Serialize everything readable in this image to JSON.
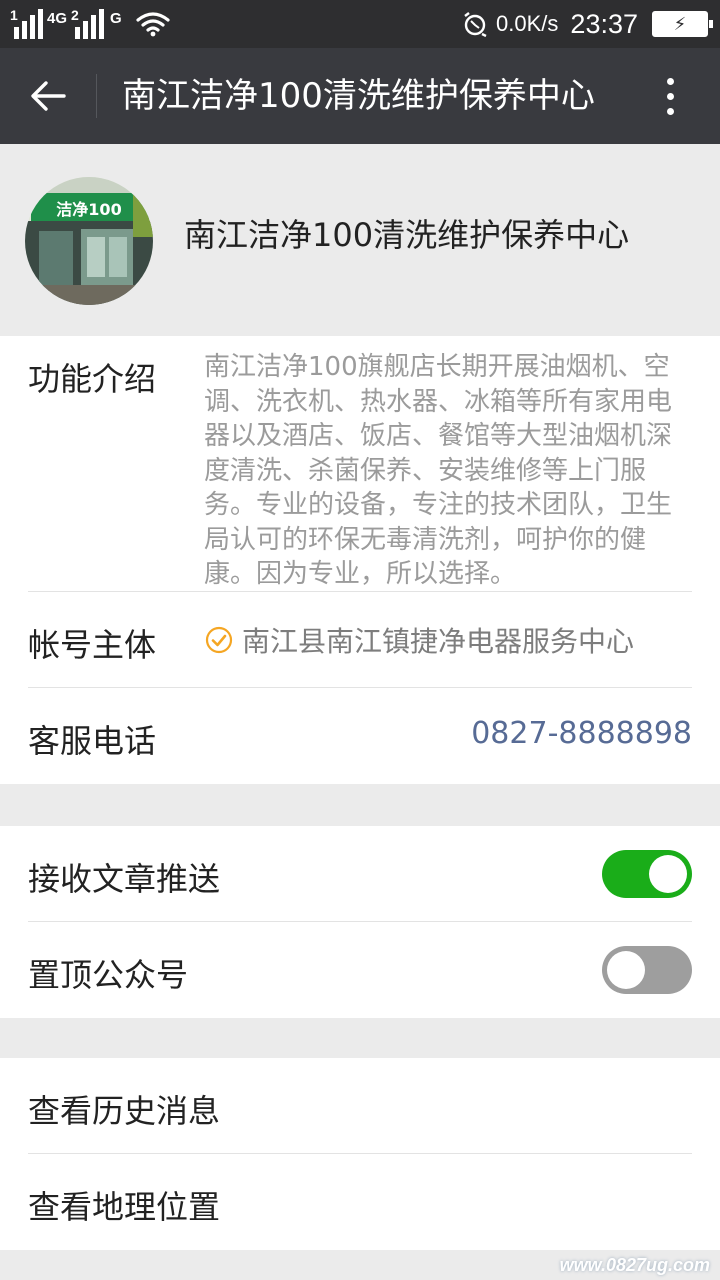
{
  "status_bar": {
    "sim1_tag": "1",
    "network_tag": "4G",
    "sim2_tag": "2",
    "network2_tag": "G",
    "speed": "0.0K/s",
    "time": "23:37",
    "wifi_icon": "wifi-icon",
    "battery_icon": "battery-charging-icon"
  },
  "app_bar": {
    "title": "南江洁净100清洗维护保养中心",
    "back_icon": "arrow-left-icon",
    "more_icon": "more-vertical-icon"
  },
  "profile": {
    "name": "南江洁净100清洗维护保养中心",
    "avatar_sign_text": "洁净100"
  },
  "info": {
    "intro_label": "功能介绍",
    "intro_text": "南江洁净100旗舰店长期开展油烟机、空调、洗衣机、热水器、冰箱等所有家用电器以及酒店、饭店、餐馆等大型油烟机深度清洗、杀菌保养、安装维修等上门服务。专业的设备，专注的技术团队，卫生局认可的环保无毒清洗剂，呵护你的健康。因为专业，所以选择。",
    "subject_label": "帐号主体",
    "subject_value": "南江县南江镇捷净电器服务中心",
    "phone_label": "客服电话",
    "phone_value": "0827-8888898"
  },
  "settings": {
    "receive_label": "接收文章推送",
    "receive_on": true,
    "pin_label": "置顶公众号",
    "pin_on": false
  },
  "links": {
    "history_label": "查看历史消息",
    "location_label": "查看地理位置"
  },
  "watermark": "www.0827ug.com",
  "colors": {
    "status_bar": "#2e2e30",
    "app_bar": "#393a3f",
    "background": "#ebebeb",
    "switch_on": "#1aad19",
    "switch_off": "#9e9e9e",
    "link_blue": "#576b95",
    "verified": "#f5a623"
  }
}
